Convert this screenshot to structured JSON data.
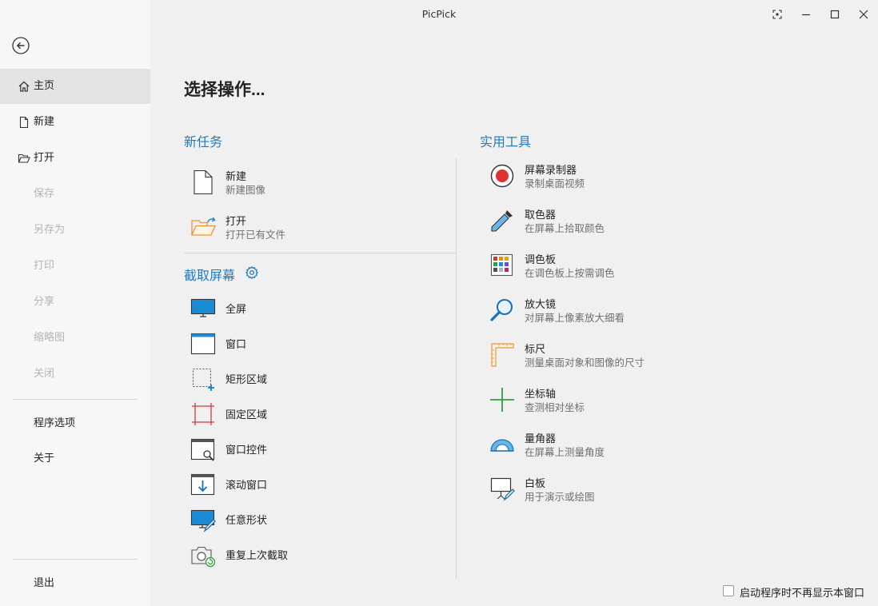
{
  "window": {
    "title": "PicPick"
  },
  "sidebar": {
    "items": [
      {
        "label": "主页",
        "icon": "home-icon",
        "active": true
      },
      {
        "label": "新建",
        "icon": "new-file-icon"
      },
      {
        "label": "打开",
        "icon": "open-folder-icon"
      },
      {
        "label": "保存",
        "disabled": true
      },
      {
        "label": "另存为",
        "disabled": true
      },
      {
        "label": "打印",
        "disabled": true
      },
      {
        "label": "分享",
        "disabled": true
      },
      {
        "label": "缩略图",
        "disabled": true
      },
      {
        "label": "关闭",
        "disabled": true
      },
      {
        "label": "程序选项"
      },
      {
        "label": "关于"
      },
      {
        "label": "退出"
      }
    ]
  },
  "main": {
    "heading": "选择操作...",
    "new_task": {
      "title": "新任务",
      "items": [
        {
          "label": "新建",
          "desc": "新建图像",
          "icon": "blank-page-icon"
        },
        {
          "label": "打开",
          "desc": "打开已有文件",
          "icon": "open-folder-icon"
        }
      ]
    },
    "capture": {
      "title": "截取屏幕",
      "settings_icon": "gear-icon",
      "items": [
        {
          "label": "全屏",
          "icon": "monitor-icon"
        },
        {
          "label": "窗口",
          "icon": "window-icon"
        },
        {
          "label": "矩形区域",
          "icon": "dashed-rectangle-icon"
        },
        {
          "label": "固定区域",
          "icon": "fixed-region-icon"
        },
        {
          "label": "窗口控件",
          "icon": "window-control-icon"
        },
        {
          "label": "滚动窗口",
          "icon": "scroll-window-icon"
        },
        {
          "label": "任意形状",
          "icon": "freehand-icon"
        },
        {
          "label": "重复上次截取",
          "icon": "repeat-capture-icon"
        }
      ]
    },
    "tools": {
      "title": "实用工具",
      "items": [
        {
          "label": "屏幕录制器",
          "desc": "录制桌面视频",
          "icon": "record-icon"
        },
        {
          "label": "取色器",
          "desc": "在屏幕上拾取颜色",
          "icon": "eyedropper-icon"
        },
        {
          "label": "调色板",
          "desc": "在调色板上按需调色",
          "icon": "palette-icon"
        },
        {
          "label": "放大镜",
          "desc": "对屏幕上像素放大细看",
          "icon": "magnifier-icon"
        },
        {
          "label": "标尺",
          "desc": "测量桌面对象和图像的尺寸",
          "icon": "ruler-icon"
        },
        {
          "label": "坐标轴",
          "desc": "查测相对坐标",
          "icon": "crosshair-icon"
        },
        {
          "label": "量角器",
          "desc": "在屏幕上测量角度",
          "icon": "protractor-icon"
        },
        {
          "label": "白板",
          "desc": "用于演示或绘图",
          "icon": "whiteboard-icon"
        }
      ]
    }
  },
  "footer": {
    "checkbox_label": "启动程序时不再显示本窗口",
    "checked": false
  },
  "colors": {
    "accent": "#1f7cc0",
    "sidebar_active": "#e3e3e3",
    "record_red": "#e03131"
  }
}
